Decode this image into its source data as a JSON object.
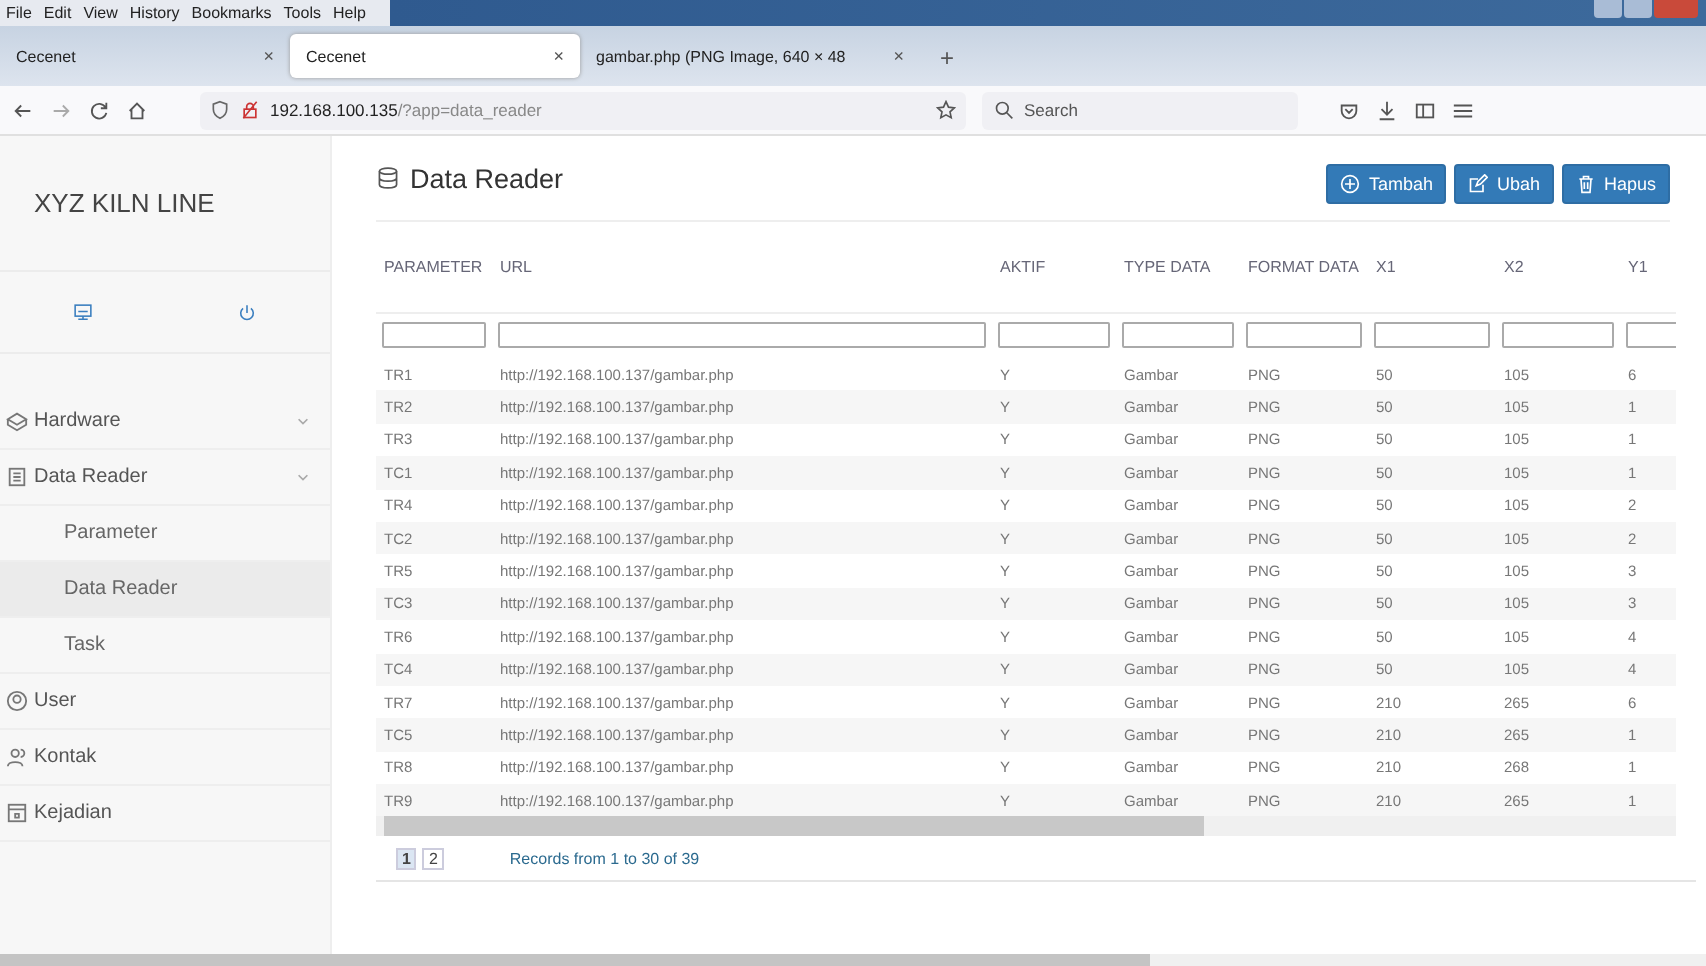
{
  "browser": {
    "menu": [
      "File",
      "Edit",
      "View",
      "History",
      "Bookmarks",
      "Tools",
      "Help"
    ],
    "tabs": [
      {
        "label": "Cecenet",
        "selected": false
      },
      {
        "label": "Cecenet",
        "selected": true
      },
      {
        "label": "gambar.php (PNG Image, 640 × 48",
        "selected": false
      }
    ],
    "close_glyph": "×",
    "new_tab": "+",
    "address": {
      "host": "192.168.100.135",
      "path": "/?app=data_reader"
    },
    "search": {
      "placeholder": "Search"
    }
  },
  "sidebar": {
    "title": "XYZ KILN LINE",
    "items": [
      {
        "label": "Hardware",
        "kind": "hardware"
      },
      {
        "label": "Data Reader",
        "kind": "reader",
        "children": [
          {
            "label": "Parameter",
            "selected": false
          },
          {
            "label": "Data Reader",
            "selected": true
          },
          {
            "label": "Task",
            "selected": false
          }
        ]
      },
      {
        "label": "User",
        "kind": "user"
      },
      {
        "label": "Kontak",
        "kind": "contact"
      },
      {
        "label": "Kejadian",
        "kind": "calendar"
      }
    ]
  },
  "page": {
    "title": "Data Reader",
    "buttons": [
      {
        "label": "Tambah",
        "kind": "add"
      },
      {
        "label": "Ubah",
        "kind": "edit"
      },
      {
        "label": "Hapus",
        "kind": "delete"
      }
    ]
  },
  "table": {
    "columns": [
      "PARAMETER",
      "URL",
      "AKTIF",
      "TYPE DATA",
      "FORMAT DATA",
      "X1",
      "X2",
      "Y1"
    ],
    "rows": [
      [
        "TR1",
        "http://192.168.100.137/gambar.php",
        "Y",
        "Gambar",
        "PNG",
        "50",
        "105",
        "6"
      ],
      [
        "TR2",
        "http://192.168.100.137/gambar.php",
        "Y",
        "Gambar",
        "PNG",
        "50",
        "105",
        "1"
      ],
      [
        "TR3",
        "http://192.168.100.137/gambar.php",
        "Y",
        "Gambar",
        "PNG",
        "50",
        "105",
        "1"
      ],
      [
        "TC1",
        "http://192.168.100.137/gambar.php",
        "Y",
        "Gambar",
        "PNG",
        "50",
        "105",
        "1"
      ],
      [
        "TR4",
        "http://192.168.100.137/gambar.php",
        "Y",
        "Gambar",
        "PNG",
        "50",
        "105",
        "2"
      ],
      [
        "TC2",
        "http://192.168.100.137/gambar.php",
        "Y",
        "Gambar",
        "PNG",
        "50",
        "105",
        "2"
      ],
      [
        "TR5",
        "http://192.168.100.137/gambar.php",
        "Y",
        "Gambar",
        "PNG",
        "50",
        "105",
        "3"
      ],
      [
        "TC3",
        "http://192.168.100.137/gambar.php",
        "Y",
        "Gambar",
        "PNG",
        "50",
        "105",
        "3"
      ],
      [
        "TR6",
        "http://192.168.100.137/gambar.php",
        "Y",
        "Gambar",
        "PNG",
        "50",
        "105",
        "4"
      ],
      [
        "TC4",
        "http://192.168.100.137/gambar.php",
        "Y",
        "Gambar",
        "PNG",
        "50",
        "105",
        "4"
      ],
      [
        "TR7",
        "http://192.168.100.137/gambar.php",
        "Y",
        "Gambar",
        "PNG",
        "210",
        "265",
        "6"
      ],
      [
        "TC5",
        "http://192.168.100.137/gambar.php",
        "Y",
        "Gambar",
        "PNG",
        "210",
        "265",
        "1"
      ],
      [
        "TR8",
        "http://192.168.100.137/gambar.php",
        "Y",
        "Gambar",
        "PNG",
        "210",
        "268",
        "1"
      ],
      [
        "TR9",
        "http://192.168.100.137/gambar.php",
        "Y",
        "Gambar",
        "PNG",
        "210",
        "265",
        "1"
      ]
    ],
    "pages": [
      {
        "label": "1",
        "selected": true
      },
      {
        "label": "2",
        "selected": false
      }
    ],
    "records": "Records from 1 to 30 of 39"
  }
}
